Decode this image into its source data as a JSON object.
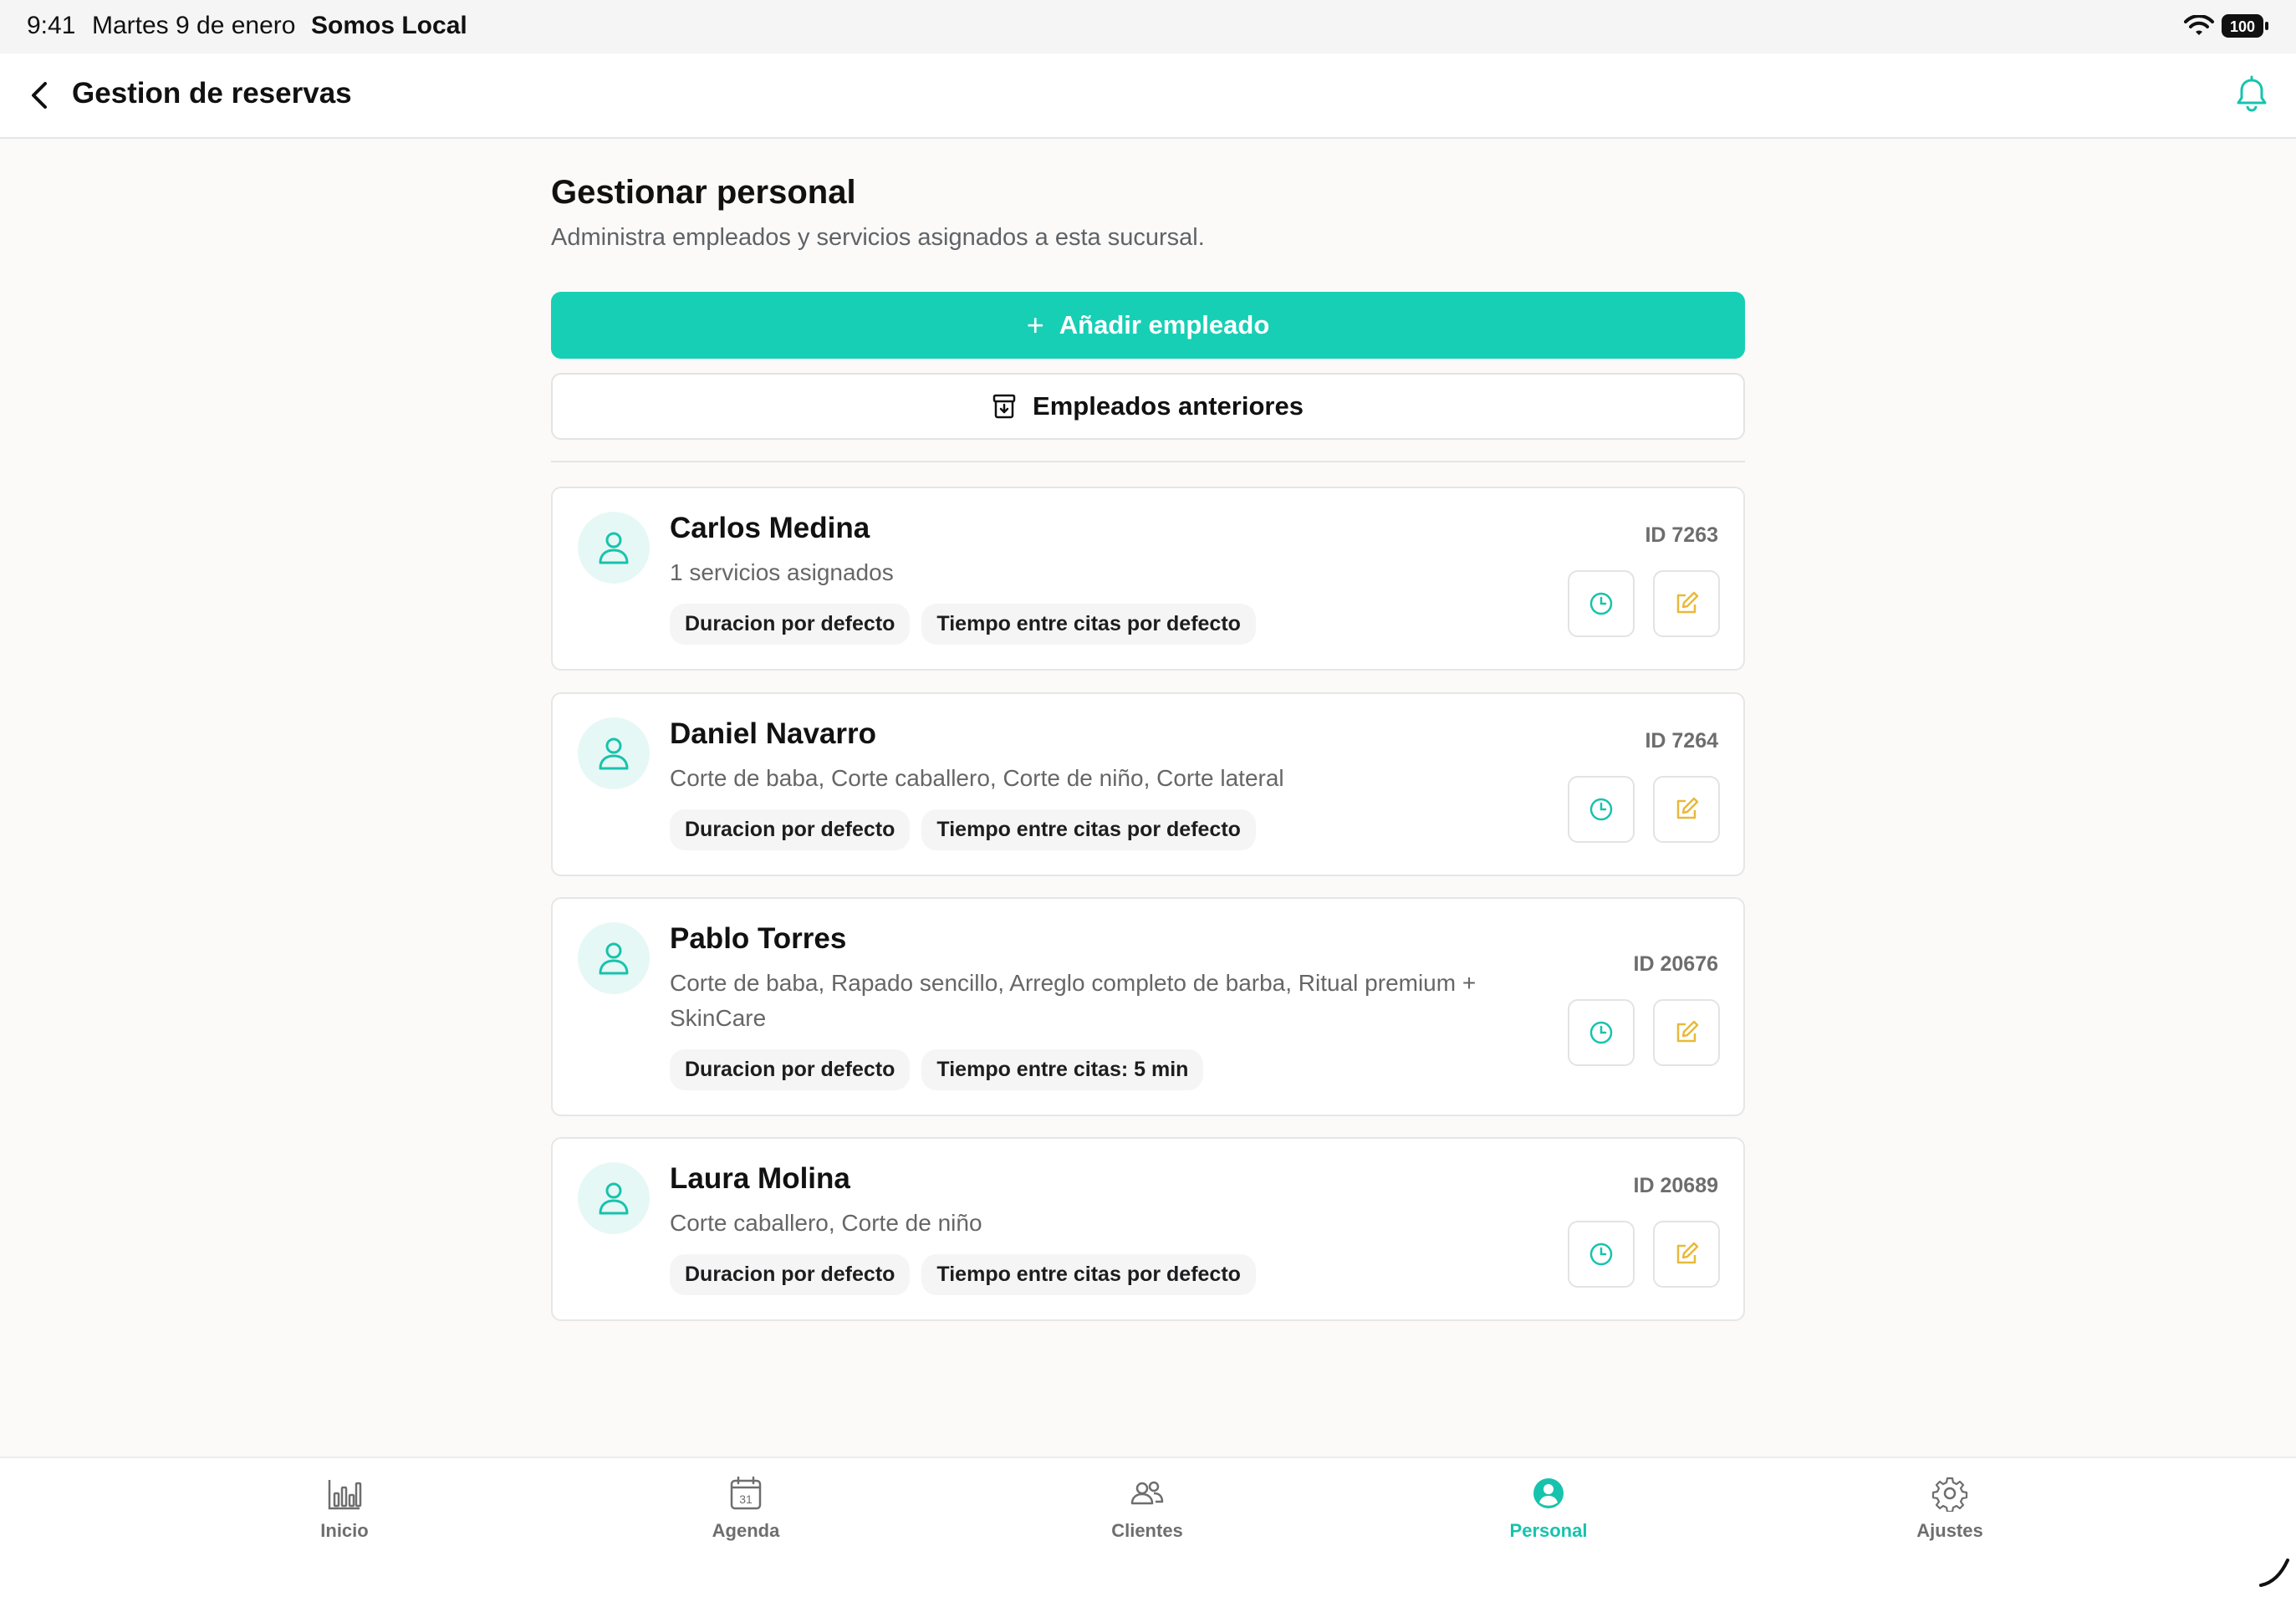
{
  "status_bar": {
    "time": "9:41",
    "date": "Martes 9 de enero",
    "app_name": "Somos Local",
    "battery": "100"
  },
  "header": {
    "title": "Gestion de reservas",
    "back_icon": "chevron-left-icon",
    "notifications_icon": "bell-icon"
  },
  "main": {
    "title": "Gestionar personal",
    "subtitle": "Administra empleados y servicios asignados a esta sucursal.",
    "add_button_label": "Añadir empleado",
    "add_button_icon": "+",
    "previous_button_label": "Empleados anteriores"
  },
  "employees": [
    {
      "name": "Carlos Medina",
      "services": "1 servicios asignados",
      "id": "ID 7263",
      "tags": [
        "Duracion por defecto",
        "Tiempo entre citas por defecto"
      ]
    },
    {
      "name": "Daniel Navarro",
      "services": "Corte de baba, Corte caballero, Corte de niño, Corte lateral",
      "id": "ID 7264",
      "tags": [
        "Duracion por defecto",
        "Tiempo entre citas por defecto"
      ]
    },
    {
      "name": "Pablo Torres",
      "services": "Corte de baba, Rapado sencillo, Arreglo completo de barba, Ritual premium + SkinCare",
      "id": "ID 20676",
      "tags": [
        "Duracion por defecto",
        "Tiempo entre citas: 5 min"
      ]
    },
    {
      "name": "Laura Molina",
      "services": "Corte caballero, Corte de niño",
      "id": "ID 20689",
      "tags": [
        "Duracion por defecto",
        "Tiempo entre citas por defecto"
      ]
    }
  ],
  "tabbar": {
    "items": [
      {
        "label": "Inicio",
        "icon": "bar-chart-icon"
      },
      {
        "label": "Agenda",
        "icon": "calendar-icon",
        "icon_text": "31"
      },
      {
        "label": "Clientes",
        "icon": "users-icon"
      },
      {
        "label": "Personal",
        "icon": "person-circle-icon",
        "active": true
      },
      {
        "label": "Ajustes",
        "icon": "gear-icon"
      }
    ]
  },
  "colors": {
    "accent": "#17cfb5",
    "edit_icon": "#e8b93a",
    "background": "#fbfaf8"
  }
}
